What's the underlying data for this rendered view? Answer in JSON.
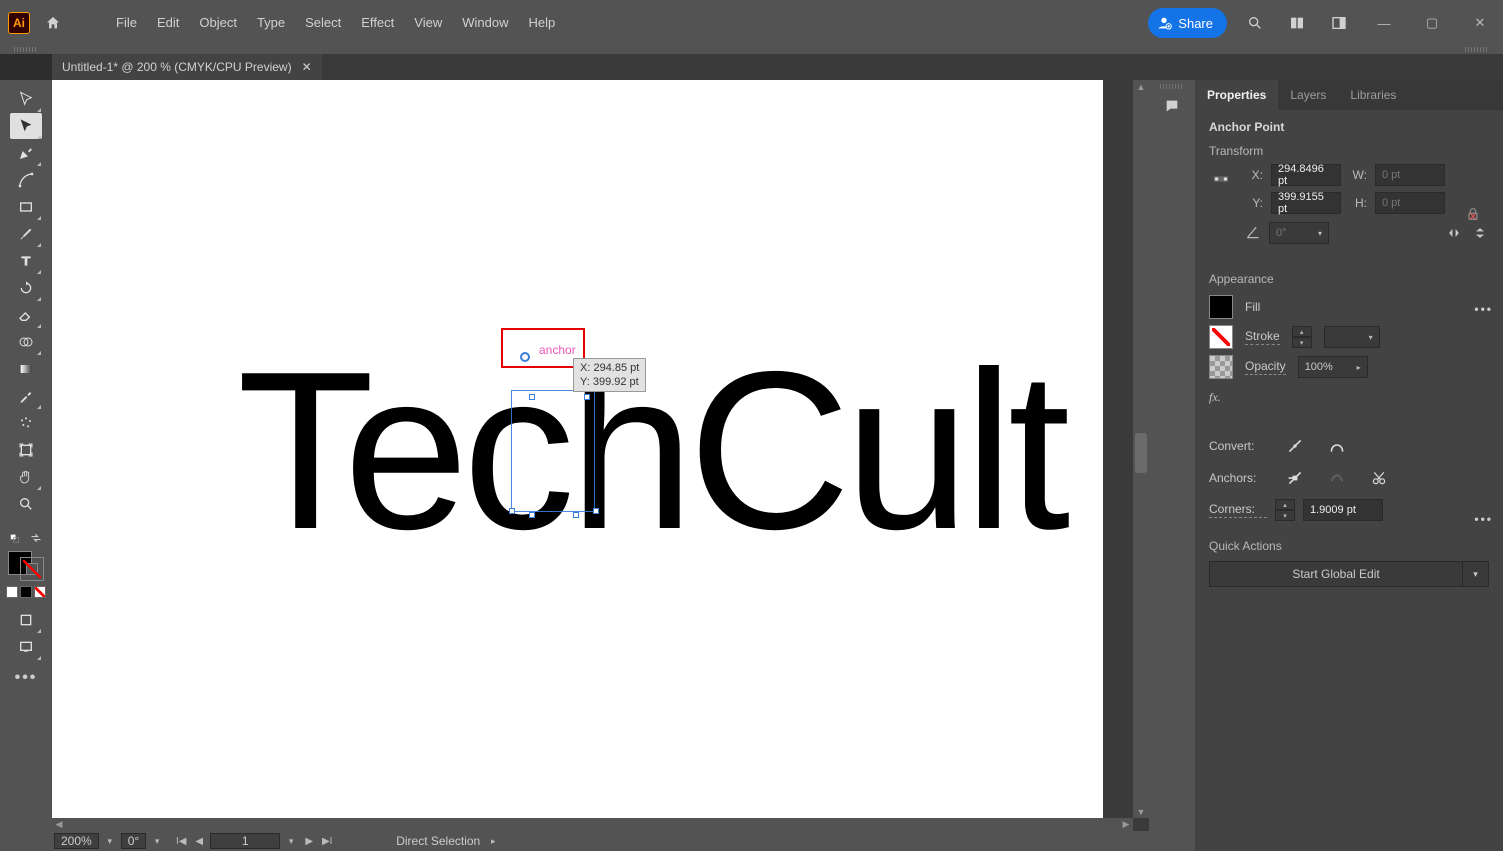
{
  "app": {
    "logo_text": "Ai"
  },
  "menus": [
    "File",
    "Edit",
    "Object",
    "Type",
    "Select",
    "Effect",
    "View",
    "Window",
    "Help"
  ],
  "share_label": "Share",
  "tab": {
    "title": "Untitled-1* @ 200 % (CMYK/CPU Preview)"
  },
  "canvas": {
    "text": "TechCult",
    "anchor_label": "anchor",
    "coord_x_lbl": "X: 294.85 pt",
    "coord_y_lbl": "Y: 399.92 pt"
  },
  "status": {
    "zoom": "200%",
    "rotation": "0°",
    "artboard": "1",
    "tool": "Direct Selection"
  },
  "panel": {
    "tabs": [
      "Properties",
      "Layers",
      "Libraries"
    ],
    "heading": "Anchor Point",
    "transform_title": "Transform",
    "x_lbl": "X:",
    "y_lbl": "Y:",
    "w_lbl": "W:",
    "h_lbl": "H:",
    "x_val": "294.8496 pt",
    "y_val": "399.9155 pt",
    "w_val": "0 pt",
    "h_val": "0 pt",
    "angle_lbl": "0°",
    "appearance_title": "Appearance",
    "fill_lbl": "Fill",
    "stroke_lbl": "Stroke",
    "opacity_lbl": "Opacity",
    "opacity_val": "100%",
    "fx_lbl": "fx.",
    "convert_lbl": "Convert:",
    "anchors_lbl": "Anchors:",
    "corners_lbl": "Corners:",
    "corners_val": "1.9009 pt",
    "quick_actions_title": "Quick Actions",
    "global_edit_btn": "Start Global Edit"
  }
}
